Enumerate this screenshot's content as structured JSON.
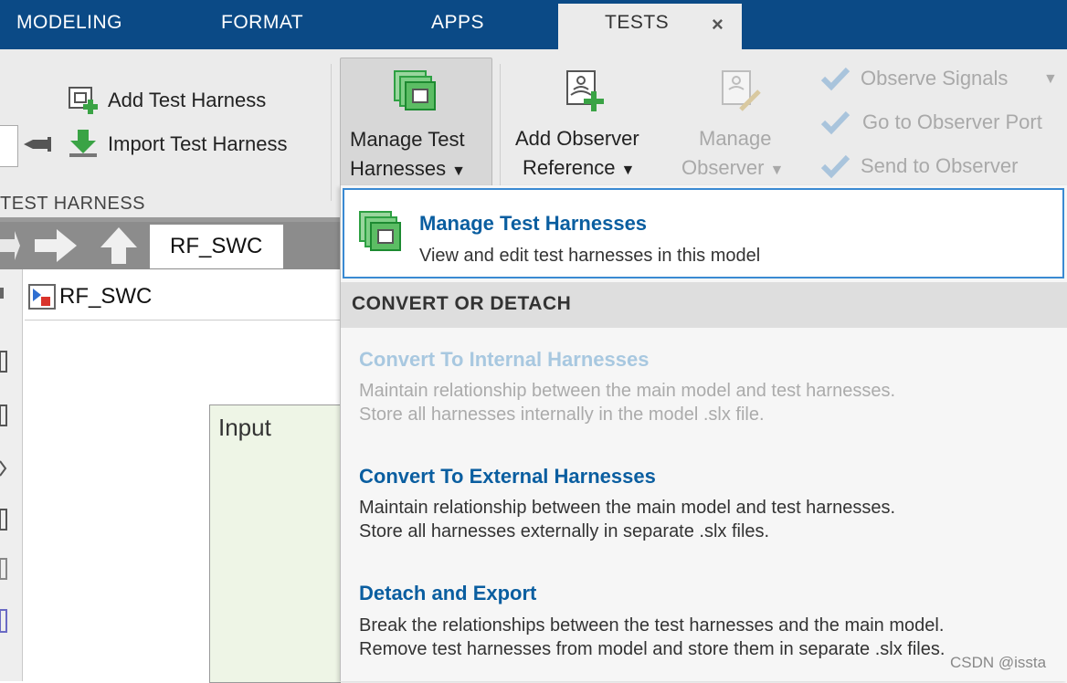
{
  "tabs": {
    "modeling": "MODELING",
    "format": "FORMAT",
    "apps": "APPS",
    "tests": "TESTS",
    "close": "×"
  },
  "ribbon": {
    "add_test_harness": "Add Test Harness",
    "import_test_harness": "Import Test Harness",
    "section_label": "TEST HARNESS",
    "manage_test_harnesses_line1": "Manage Test",
    "manage_test_harnesses_line2": "Harnesses",
    "add_observer_line1": "Add Observer",
    "add_observer_line2": "Reference",
    "manage_observer_line1": "Manage",
    "manage_observer_line2": "Observer",
    "observe_signals": "Observe Signals",
    "go_to_observer_port": "Go to Observer Port",
    "send_to_observer": "Send to Observer",
    "caret": "▼"
  },
  "model": {
    "tab_label": "RF_SWC",
    "address": "RF_SWC",
    "block_label": "Input"
  },
  "dropdown": {
    "manage": {
      "title": "Manage Test Harnesses",
      "desc": "View and edit test harnesses in this model"
    },
    "section_header": "CONVERT OR DETACH",
    "convert_internal": {
      "title": "Convert To Internal Harnesses",
      "desc1": "Maintain relationship between the main model and test harnesses.",
      "desc2": "Store all harnesses internally in the model .slx file."
    },
    "convert_external": {
      "title": "Convert To External Harnesses",
      "desc1": "Maintain relationship between the main model and test harnesses.",
      "desc2": "Store all harnesses externally in separate .slx files."
    },
    "detach": {
      "title": "Detach and Export",
      "desc1": "Break the relationships between the test harnesses and the main model.",
      "desc2": "Remove test harnesses from model and store them in separate .slx files."
    }
  },
  "watermark": "CSDN @issta",
  "colors": {
    "tab_bar": "#0b4a86",
    "ribbon_bg": "#ebebeb",
    "link_blue": "#0a5ea0",
    "focus_border": "#3a8ad2",
    "harness_green": "#2ea043"
  }
}
